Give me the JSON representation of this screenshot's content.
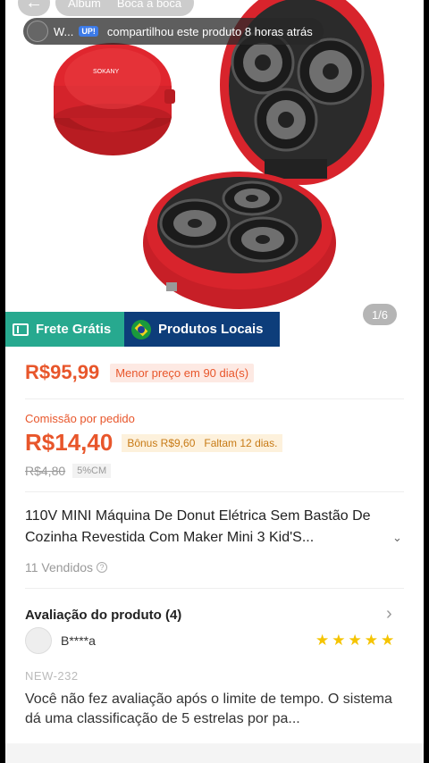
{
  "header": {
    "back_icon": "arrow-left-icon",
    "tabs": [
      "Álbum",
      "Boca a boca"
    ]
  },
  "share_banner": {
    "user": "W...",
    "badge": "UP!",
    "text": "compartilhou este produto 8 horas atrás"
  },
  "gallery": {
    "counter": "1/6"
  },
  "badges": {
    "frete": "Frete Grátis",
    "locais": "Produtos Locais"
  },
  "price": {
    "current": "R$95,99",
    "tag": "Menor preço em 90 dia(s)"
  },
  "commission": {
    "label": "Comissão por pedido",
    "amount": "R$14,40",
    "bonus": "Bônus R$9,60",
    "remaining": "Faltam 12 dias.",
    "old_amount": "R$4,80",
    "rate": "5%CM"
  },
  "product": {
    "title": "110V MINI Máquina De Donut Elétrica Sem Bastão De Cozinha Revestida Com Maker Mini 3 Kid'S...",
    "sold": "11 Vendidos"
  },
  "reviews": {
    "heading": "Avaliação do produto (4)",
    "user": "B****a",
    "rating": 5,
    "variant": "NEW-232",
    "text": "Você não fez avaliação após o limite de tempo. O sistema dá uma classificação de 5 estrelas por pa..."
  },
  "colors": {
    "accent": "#e8562b",
    "frete_bg": "#27a98f",
    "locais_bg": "#0d3d7a",
    "star": "#f5c400",
    "appliance_red": "#d8242c"
  }
}
